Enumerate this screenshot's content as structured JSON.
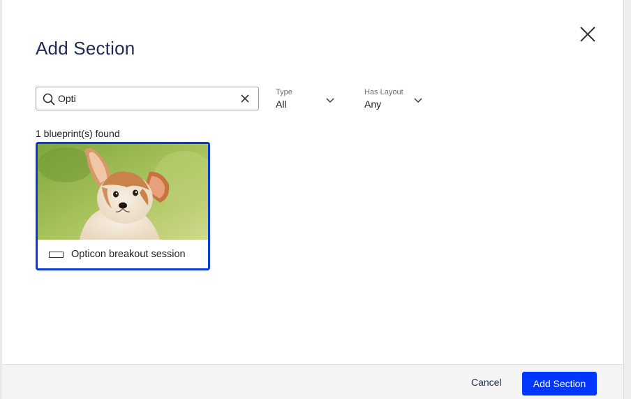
{
  "dialog": {
    "title": "Add Section",
    "close_icon": "close-icon"
  },
  "search": {
    "value": "Opti",
    "placeholder": "Search",
    "search_icon": "search-icon",
    "clear_icon": "clear-icon"
  },
  "filters": [
    {
      "label": "Type",
      "value": "All",
      "icon": "chevron-down-icon"
    },
    {
      "label": "Has Layout",
      "value": "Any",
      "icon": "chevron-down-icon"
    }
  ],
  "results": {
    "count_text": "1 blueprint(s) found",
    "items": [
      {
        "label": "Opticon breakout session",
        "icon": "section-icon",
        "thumbnail": "puppy-photo"
      }
    ]
  },
  "footer": {
    "cancel_label": "Cancel",
    "primary_label": "Add Section"
  },
  "colors": {
    "accent": "#0037ff",
    "selected_border": "#0b3ad3",
    "title": "#1f2a55"
  }
}
